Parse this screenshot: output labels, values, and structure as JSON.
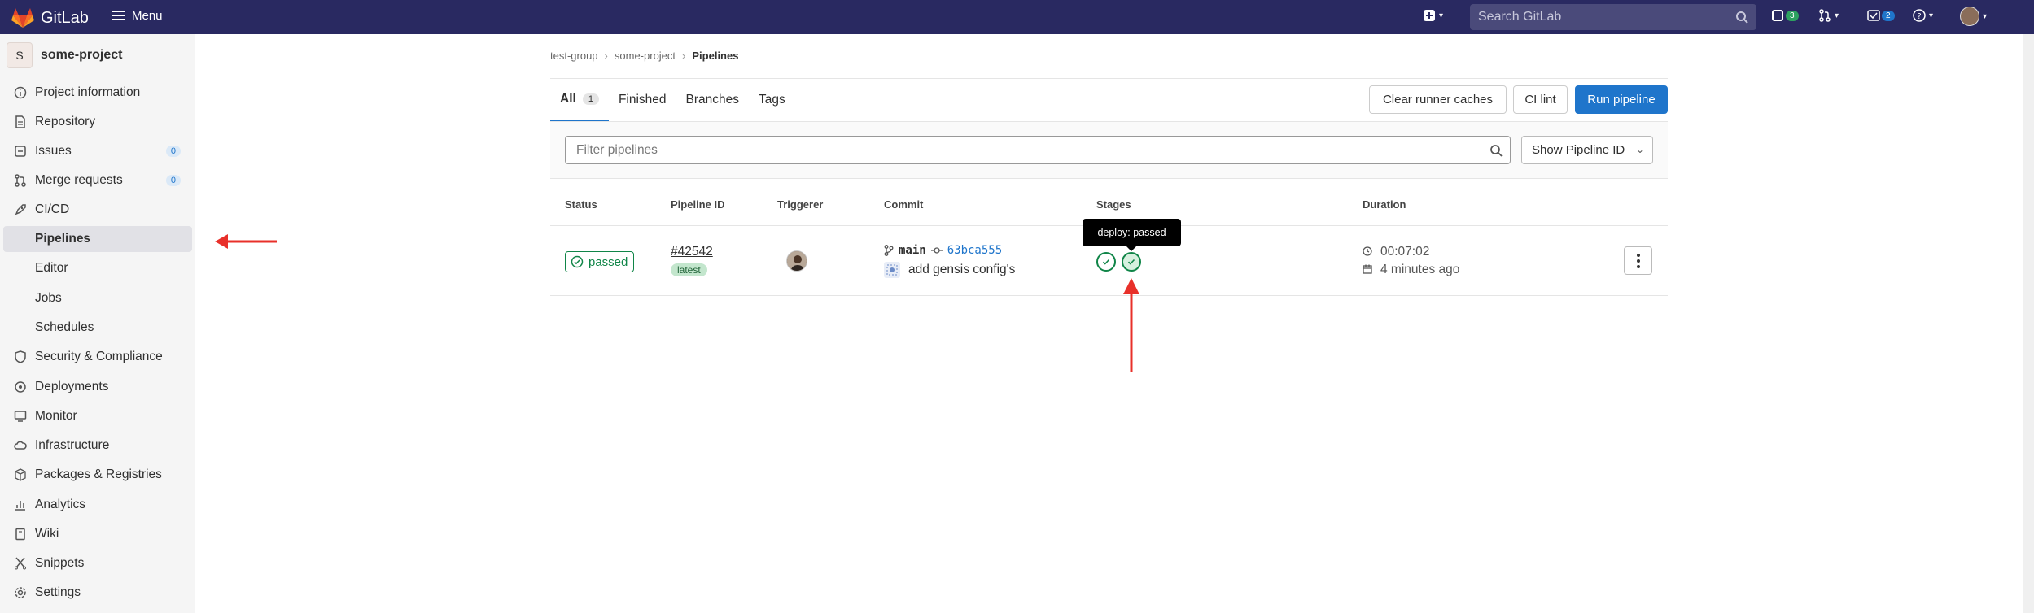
{
  "app": {
    "name": "GitLab",
    "menu_label": "Menu"
  },
  "search": {
    "placeholder": "Search GitLab"
  },
  "topbar": {
    "issues_count": "3",
    "todos_count": "2"
  },
  "project": {
    "initial": "S",
    "name": "some-project"
  },
  "sidebar": {
    "items": [
      {
        "label": "Project information",
        "icon": "info-icon"
      },
      {
        "label": "Repository",
        "icon": "document-icon"
      },
      {
        "label": "Issues",
        "icon": "issues-icon",
        "count": "0"
      },
      {
        "label": "Merge requests",
        "icon": "merge-request-icon",
        "count": "0"
      },
      {
        "label": "CI/CD",
        "icon": "rocket-icon"
      },
      {
        "label": "Pipelines",
        "active": true
      },
      {
        "label": "Editor"
      },
      {
        "label": "Jobs"
      },
      {
        "label": "Schedules"
      },
      {
        "label": "Security & Compliance",
        "icon": "shield-icon"
      },
      {
        "label": "Deployments",
        "icon": "deployments-icon"
      },
      {
        "label": "Monitor",
        "icon": "monitor-icon"
      },
      {
        "label": "Infrastructure",
        "icon": "cloud-icon"
      },
      {
        "label": "Packages & Registries",
        "icon": "package-icon"
      },
      {
        "label": "Analytics",
        "icon": "chart-icon"
      },
      {
        "label": "Wiki",
        "icon": "book-icon"
      },
      {
        "label": "Snippets",
        "icon": "scissors-icon"
      },
      {
        "label": "Settings",
        "icon": "gear-icon"
      }
    ]
  },
  "breadcrumb": {
    "group": "test-group",
    "project": "some-project",
    "current": "Pipelines"
  },
  "tabs": [
    {
      "label": "All",
      "count": "1"
    },
    {
      "label": "Finished"
    },
    {
      "label": "Branches"
    },
    {
      "label": "Tags"
    }
  ],
  "actions": {
    "clear_caches": "Clear runner caches",
    "ci_lint": "CI lint",
    "run_pipeline": "Run pipeline"
  },
  "filter": {
    "placeholder": "Filter pipelines",
    "show_id_label": "Show Pipeline ID"
  },
  "table": {
    "headers": {
      "status": "Status",
      "pipeline_id": "Pipeline ID",
      "triggerer": "Triggerer",
      "commit": "Commit",
      "stages": "Stages",
      "duration": "Duration"
    },
    "row": {
      "status": "passed",
      "pipeline_id": "#42542",
      "tag": "latest",
      "branch": "main",
      "sha": "63bca555",
      "message": "add gensis config's",
      "tooltip": "deploy: passed",
      "duration": "00:07:02",
      "finished": "4 minutes ago"
    }
  },
  "colors": {
    "topbar": "#292961",
    "primary": "#1f75cb",
    "success": "#108548",
    "annotation": "#e8302a"
  }
}
